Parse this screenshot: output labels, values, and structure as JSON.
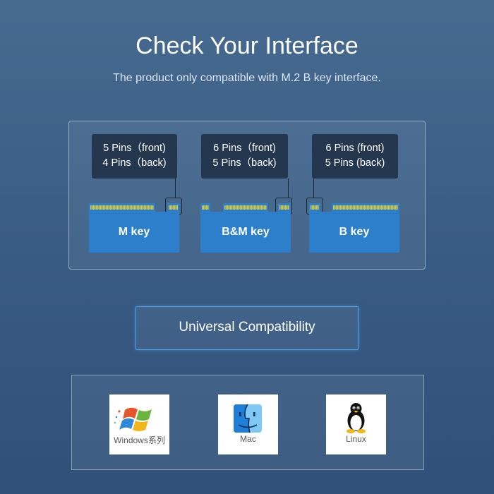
{
  "header": {
    "title": "Check Your Interface",
    "subtitle": "The product only compatible with M.2 B key interface."
  },
  "keys": [
    {
      "name": "M key",
      "front": "5 Pins（front)",
      "back": "4 Pins（back)"
    },
    {
      "name": "B&M key",
      "front": "6 Pins（front)",
      "back": "5 Pins（back)"
    },
    {
      "name": "B key",
      "front": "6 Pins (front)",
      "back": "5 Pins (back)"
    }
  ],
  "compatibility": {
    "label": "Universal Compatibility"
  },
  "os": [
    {
      "label": "Windows系列",
      "icon": "windows-logo-icon"
    },
    {
      "label": "Mac",
      "icon": "mac-finder-icon"
    },
    {
      "label": "Linux",
      "icon": "linux-tux-icon"
    }
  ],
  "colors": {
    "background": "#3a5d85",
    "board": "#2d7fcb",
    "tooltip": "#25374e",
    "accent_border": "#49a6ee"
  }
}
